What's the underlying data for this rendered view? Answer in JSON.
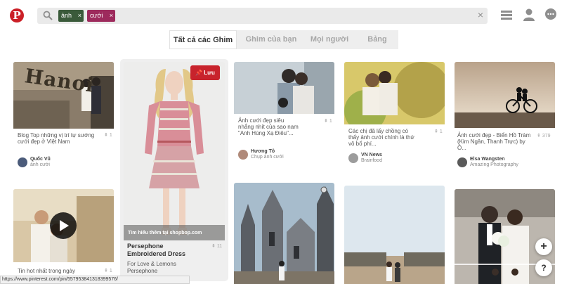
{
  "header": {
    "logo_text": "P",
    "search_chips": [
      "ảnh",
      "cưới"
    ],
    "chip_remove": "×",
    "clear_search": "×"
  },
  "tabs": [
    "Tất cả các Ghim",
    "Ghim của bạn",
    "Mọi người",
    "Bảng"
  ],
  "pins": {
    "p1": {
      "title": "Blog Top những vị trí tự sướng cưới đẹp ở Việt Nam",
      "saves": "1",
      "author": "Quốc Vũ",
      "board": "ảnh cưới",
      "image_text": "Hanoi"
    },
    "p2": {
      "title": "Tin hot nhất trong ngày",
      "saves": "1"
    },
    "p3": {
      "save_label": "Lưu",
      "source": "Tìm hiểu thêm tại shopbop.com",
      "title_line1": "Persephone",
      "title_line2": "Embroidered Dress",
      "saves": "11",
      "subtitle_line1": "For Love & Lemons",
      "subtitle_line2": "Persephone"
    },
    "p4": {
      "title": "Ảnh cưới đẹp siêu nhắng nhít của sao nam \"Anh Hùng Xạ Điêu\"...",
      "saves": "1",
      "author": "Hương Tô",
      "board": "Chụp ảnh cưới"
    },
    "p5": {
      "title": "Các chị đã lấy chồng có thấy ảnh cưới chính là thứ vô bổ phí...",
      "saves": "1",
      "author": "VN News",
      "board": "Brainfood"
    },
    "p6": {
      "title": "Ảnh cưới đẹp - Biển Hồ Tràm (Kim Ngân, Thanh Trực) by Ô...",
      "saves": "379",
      "author": "Elsa Wangsten",
      "board": "Amazing Photography"
    }
  },
  "fab_add": "+",
  "fab_help": "?",
  "status_url": "https://www.pinterest.com/pin/557953841318399576/",
  "colors": {
    "brand_red": "#cb2027",
    "save_red": "#c8232c"
  }
}
